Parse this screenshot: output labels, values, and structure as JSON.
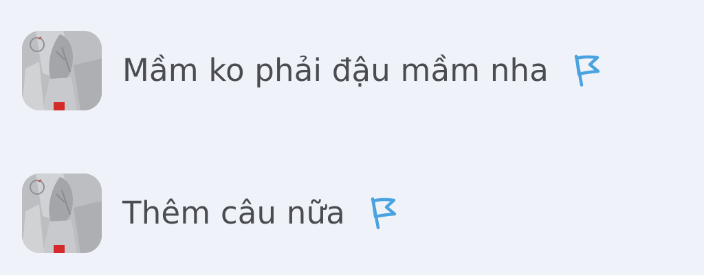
{
  "comments": [
    {
      "text": "Mầm ko phải đậu mầm nha",
      "avatar_icon": "user-avatar",
      "flag_icon": "flag-icon"
    },
    {
      "text": "Thêm câu nữa",
      "avatar_icon": "user-avatar",
      "flag_icon": "flag-icon"
    }
  ],
  "colors": {
    "background": "#eff3f9",
    "text": "#4a4c52",
    "flag": "#4aa3e0"
  }
}
